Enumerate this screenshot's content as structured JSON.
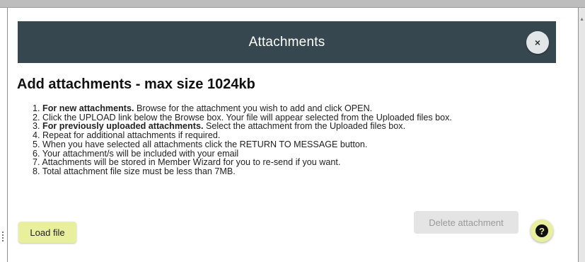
{
  "dialog": {
    "title": "Attachments",
    "close_label": "×",
    "heading": "Add attachments - max size 1024kb",
    "instructions": [
      {
        "num": "1.",
        "bold": "For new attachments.",
        "text": " Browse for the attachment you wish to add and click OPEN."
      },
      {
        "num": "2.",
        "bold": "",
        "text": "Click the UPLOAD link below the Browse box. Your file will appear selected from the Uploaded files box."
      },
      {
        "num": "3.",
        "bold": "For previously uploaded attachments.",
        "text": " Select the attachment from the Uploaded files box."
      },
      {
        "num": "4.",
        "bold": "",
        "text": "Repeat for additional attachments if required."
      },
      {
        "num": "5.",
        "bold": "",
        "text": "When you have selected all attachments click the RETURN TO MESSAGE button."
      },
      {
        "num": "6.",
        "bold": "",
        "text": "Your attachment/s will be included with your email"
      },
      {
        "num": "7.",
        "bold": "",
        "text": "Attachments will be stored in Member Wizard for you to re-send if you want."
      },
      {
        "num": "8.",
        "bold": "",
        "text": "Total attachment file size must be less than 7MB."
      }
    ],
    "load_file_label": "Load file",
    "delete_attachment_label": "Delete attachment",
    "help_label": "?",
    "help_icon": "question-circle-icon",
    "close_icon": "close-icon"
  },
  "colors": {
    "header_bg": "#37474f",
    "button_yellow": "#e8ef9d",
    "disabled_bg": "#e4e4e4",
    "disabled_text": "#9a9a9a"
  }
}
